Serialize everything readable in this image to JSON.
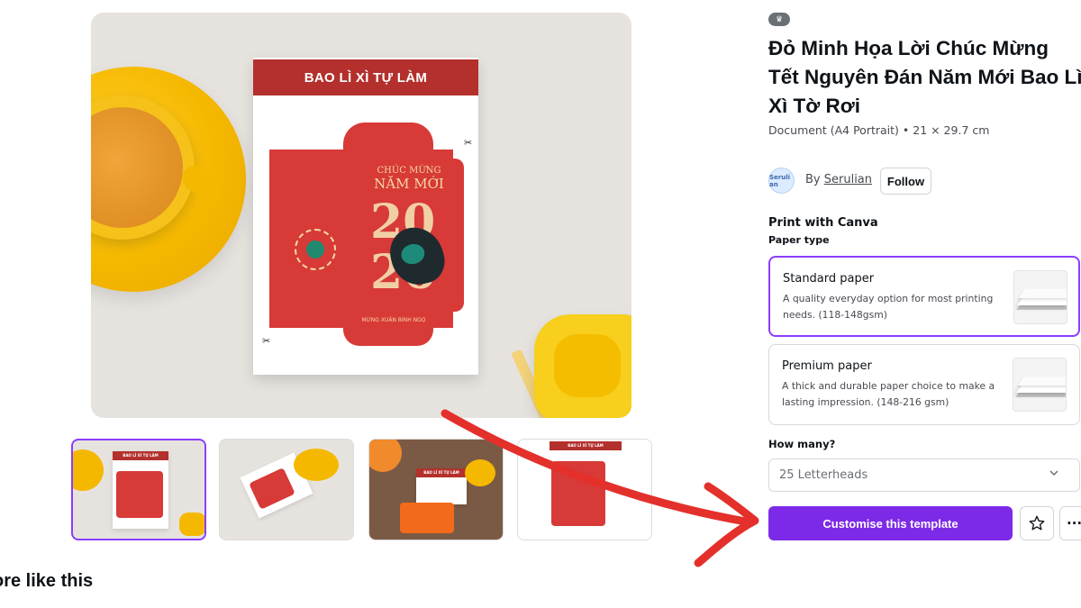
{
  "preview": {
    "paper_header": "BAO LÌ XÌ TỰ LÀM",
    "greeting_small": "CHÚC MỪNG",
    "greeting_large": "NĂM MỚI",
    "year": "20\n26",
    "subtitle": "MỪNG XUÂN BÍNH NGỌ"
  },
  "thumbnails": [
    {
      "label": "thumbnail-1",
      "header": "BAO LÌ XÌ TỰ LÀM"
    },
    {
      "label": "thumbnail-2"
    },
    {
      "label": "thumbnail-3",
      "header": "BAO LÌ XÌ TỰ LÀM"
    },
    {
      "label": "thumbnail-4",
      "header": "BAO LÌ XÌ TỰ LÀM"
    }
  ],
  "more_like_this": "ore like this",
  "panel": {
    "title": "Đỏ Minh Họa Lời Chúc Mừng Tết Nguyên Đán Năm Mới Bao Lì Xì Tờ Rơi",
    "meta": "Document (A4 Portrait) • 21 × 29.7 cm",
    "avatar_text": "Seruli an",
    "by_prefix": "By ",
    "author": "Serulian",
    "follow_label": "Follow",
    "print_title": "Print with Canva",
    "paper_type_label": "Paper type",
    "options": [
      {
        "title": "Standard paper",
        "desc": "A quality everyday option for most printing needs. (118-148gsm)",
        "selected": true
      },
      {
        "title": "Premium paper",
        "desc": "A thick and durable paper choice to make a lasting impression. (148-216 gsm)",
        "selected": false
      }
    ],
    "how_many_label": "How many?",
    "quantity_value": "25 Letterheads",
    "cta_label": "Customise this template",
    "more_label": "···"
  },
  "icons": {
    "crown": "crown-icon",
    "star": "star-icon",
    "chevron": "chevron-down-icon",
    "scissors": "scissors-icon"
  },
  "colors": {
    "accent": "#7d2ae8",
    "selected_border": "#8b3dff",
    "envelope_red": "#d73a37",
    "header_red": "#b3302c",
    "arrow_red": "#e4302b"
  }
}
